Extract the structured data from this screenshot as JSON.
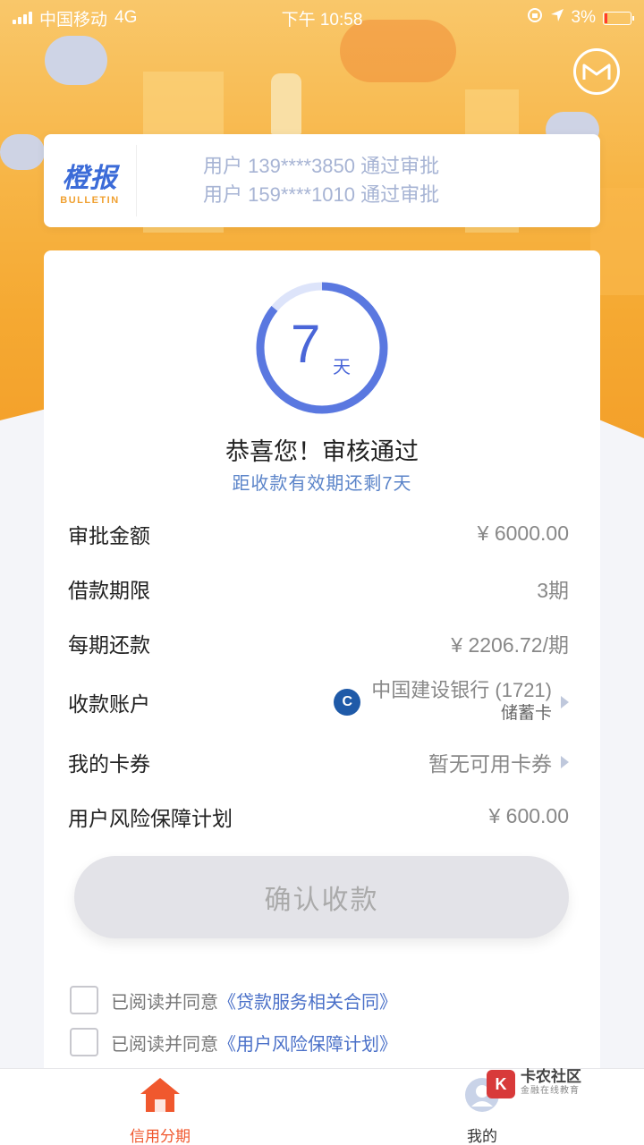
{
  "status_bar": {
    "carrier": "中国移动",
    "network": "4G",
    "time": "下午 10:58",
    "battery": "3%"
  },
  "bulletin": {
    "logo_cn": "橙报",
    "logo_en": "BULLETIN",
    "items": [
      "用户 139****3850 通过审批",
      "用户 159****1010 通过审批"
    ]
  },
  "countdown": {
    "days": "7",
    "unit": "天",
    "progress_fraction": 0.86
  },
  "result": {
    "title": "恭喜您！审核通过",
    "subtitle": "距收款有效期还剩7天"
  },
  "details": {
    "amount_label": "审批金额",
    "amount_value": "¥ 6000.00",
    "term_label": "借款期限",
    "term_value": "3期",
    "installment_label": "每期还款",
    "installment_value": "¥ 2206.72/期",
    "account_label": "收款账户",
    "account_bank": "中国建设银行 (1721)",
    "account_type": "储蓄卡",
    "coupon_label": "我的卡券",
    "coupon_value": "暂无可用卡券",
    "protection_label": "用户风险保障计划",
    "protection_value": "¥ 600.00"
  },
  "confirm_button": "确认收款",
  "agreements": [
    {
      "prefix": "已阅读并同意",
      "link": "《贷款服务相关合同》"
    },
    {
      "prefix": "已阅读并同意",
      "link": "《用户风险保障计划》"
    }
  ],
  "tabbar": {
    "tab1": "信用分期",
    "tab2": "我的"
  },
  "watermark": {
    "main": "卡农社区",
    "sub": "金融在线教育"
  },
  "colors": {
    "accent_blue": "#4a66d8",
    "tab_active": "#f0582e",
    "hero_orange": "#f5a932"
  }
}
